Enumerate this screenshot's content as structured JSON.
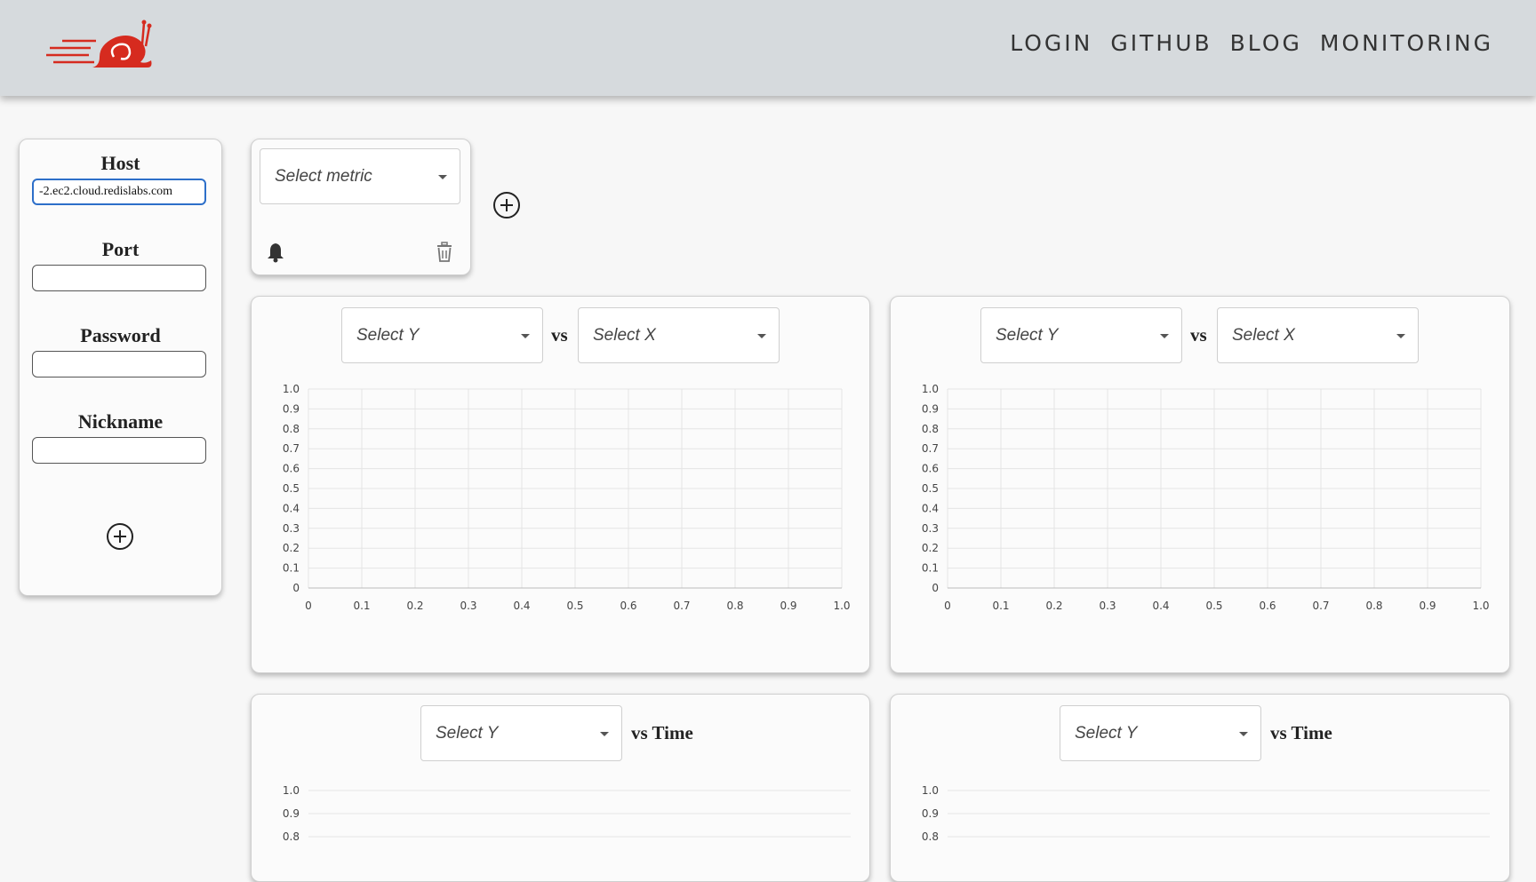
{
  "nav": {
    "items": [
      "LOGIN",
      "GITHUB",
      "BLOG",
      "MONITORING"
    ]
  },
  "connection": {
    "host_label": "Host",
    "host_value": "-2.ec2.cloud.redislabs.com",
    "port_label": "Port",
    "port_value": "",
    "password_label": "Password",
    "password_value": "",
    "nickname_label": "Nickname",
    "nickname_value": ""
  },
  "metric_card": {
    "select_placeholder": "Select metric"
  },
  "scatter_panels": [
    {
      "y_select": "Select Y",
      "vs": "vs",
      "x_select": "Select X"
    },
    {
      "y_select": "Select Y",
      "vs": "vs",
      "x_select": "Select X"
    }
  ],
  "time_panels": [
    {
      "y_select": "Select Y",
      "vs": "vs Time"
    },
    {
      "y_select": "Select Y",
      "vs": "vs Time"
    }
  ],
  "icons": {
    "logo": "snail-logo",
    "add_connection": "plus-circle-icon",
    "add_metric": "plus-circle-icon",
    "alert": "bell-icon",
    "delete": "trash-icon",
    "dropdown": "chevron-down-icon"
  },
  "colors": {
    "topbar": "#d6dadd",
    "logo_red": "#d62b1f",
    "focus_border": "#2d6fc9"
  },
  "chart_data": [
    {
      "type": "scatter",
      "x": [],
      "y": [],
      "xlim": [
        0,
        1
      ],
      "ylim": [
        0,
        1
      ],
      "x_ticks": [
        "0",
        "0.1",
        "0.2",
        "0.3",
        "0.4",
        "0.5",
        "0.6",
        "0.7",
        "0.8",
        "0.9",
        "1.0"
      ],
      "y_ticks": [
        "0",
        "0.1",
        "0.2",
        "0.3",
        "0.4",
        "0.5",
        "0.6",
        "0.7",
        "0.8",
        "0.9",
        "1.0"
      ],
      "grid": true
    },
    {
      "type": "scatter",
      "x": [],
      "y": [],
      "xlim": [
        0,
        1
      ],
      "ylim": [
        0,
        1
      ],
      "x_ticks": [
        "0",
        "0.1",
        "0.2",
        "0.3",
        "0.4",
        "0.5",
        "0.6",
        "0.7",
        "0.8",
        "0.9",
        "1.0"
      ],
      "y_ticks": [
        "0",
        "0.1",
        "0.2",
        "0.3",
        "0.4",
        "0.5",
        "0.6",
        "0.7",
        "0.8",
        "0.9",
        "1.0"
      ],
      "grid": true
    },
    {
      "type": "line",
      "x": [],
      "y": [],
      "ylim": [
        0,
        1
      ],
      "y_ticks": [
        "1.0",
        "0.9",
        "0.8"
      ],
      "grid": true
    },
    {
      "type": "line",
      "x": [],
      "y": [],
      "ylim": [
        0,
        1
      ],
      "y_ticks": [
        "1.0",
        "0.9",
        "0.8"
      ],
      "grid": true
    }
  ]
}
